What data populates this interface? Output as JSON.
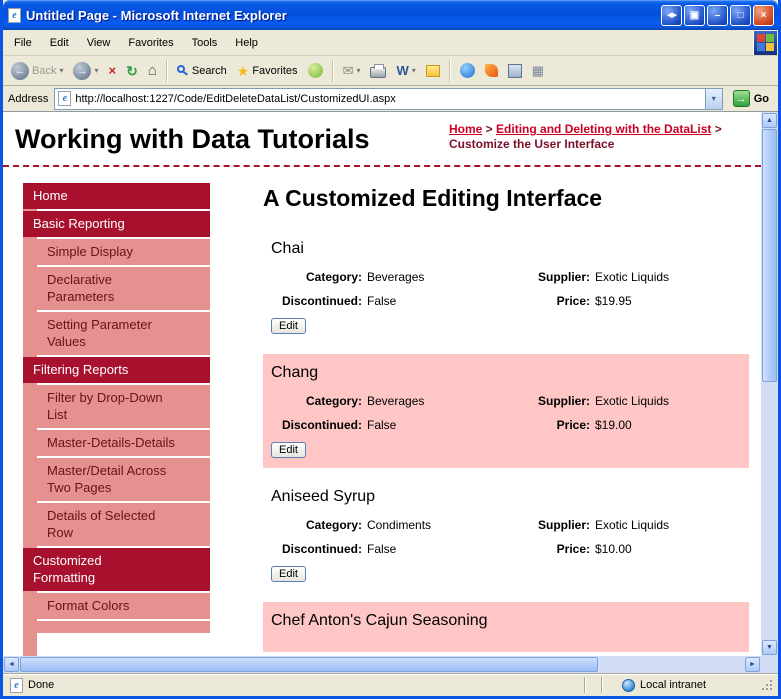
{
  "window": {
    "title": "Untitled Page - Microsoft Internet Explorer",
    "status_text": "Done",
    "zone_text": "Local intranet"
  },
  "menu": {
    "items": [
      "File",
      "Edit",
      "View",
      "Favorites",
      "Tools",
      "Help"
    ]
  },
  "toolbar": {
    "back_label": "Back",
    "search_label": "Search",
    "favorites_label": "Favorites"
  },
  "address": {
    "label": "Address",
    "url": "http://localhost:1227/Code/EditDeleteDataList/CustomizedUI.aspx",
    "go_label": "Go"
  },
  "glyphs": {
    "back_arrow": "←",
    "forward_arrow": "→",
    "dropdown": "▾",
    "stop": "×",
    "refresh": "↻",
    "home": "⌂",
    "star": "★",
    "mail": "✉",
    "word": "W",
    "grid": "▦",
    "go_arrow": "→",
    "minimize": "–",
    "maximize": "□",
    "close": "×",
    "title_extra1": "◀▶",
    "title_extra2": "▣",
    "up": "▲",
    "down": "▼",
    "left": "◄",
    "right": "►"
  },
  "page": {
    "site_title": "Working with Data Tutorials",
    "breadcrumb": {
      "separator": ">",
      "items": [
        {
          "label": "Home",
          "link": true
        },
        {
          "label": "Editing and Deleting with the DataList",
          "link": true
        },
        {
          "label": "Customize the User Interface",
          "link": false
        }
      ]
    },
    "sidebar": [
      {
        "label": "Home",
        "type": "header"
      },
      {
        "label": "Basic Reporting",
        "type": "header"
      },
      {
        "label": "Simple Display",
        "type": "item"
      },
      {
        "label": "Declarative Parameters",
        "type": "item"
      },
      {
        "label": "Setting Parameter Values",
        "type": "item"
      },
      {
        "label": "Filtering Reports",
        "type": "header"
      },
      {
        "label": "Filter by Drop-Down List",
        "type": "item"
      },
      {
        "label": "Master-Details-Details",
        "type": "item"
      },
      {
        "label": "Master/Detail Across Two Pages",
        "type": "item"
      },
      {
        "label": "Details of Selected Row",
        "type": "item"
      },
      {
        "label": "Customized Formatting",
        "type": "header"
      },
      {
        "label": "Format Colors",
        "type": "item"
      },
      {
        "label": "",
        "type": "item",
        "partial": true
      }
    ],
    "heading": "A Customized Editing Interface",
    "labels": {
      "category": "Category:",
      "supplier": "Supplier:",
      "discontinued": "Discontinued:",
      "price": "Price:",
      "edit": "Edit"
    },
    "products": [
      {
        "name": "Chai",
        "category": "Beverages",
        "supplier": "Exotic Liquids",
        "discontinued": "False",
        "price": "$19.95",
        "highlighted": false
      },
      {
        "name": "Chang",
        "category": "Beverages",
        "supplier": "Exotic Liquids",
        "discontinued": "False",
        "price": "$19.00",
        "highlighted": true
      },
      {
        "name": "Aniseed Syrup",
        "category": "Condiments",
        "supplier": "Exotic Liquids",
        "discontinued": "False",
        "price": "$10.00",
        "highlighted": false
      },
      {
        "name": "Chef Anton's Cajun Seasoning",
        "highlighted": true,
        "partial": true
      }
    ]
  },
  "colors": {
    "sidebar_header_bg": "#a8112e",
    "sidebar_header_text": "#ffffff",
    "sidebar_item_bg": "#e59190",
    "sidebar_item_text": "#6b1212",
    "link_color": "#cc0022",
    "breadcrumb_current": "#7a1028",
    "highlight_bg": "#ffc6c6",
    "rule_color": "#a8112e"
  }
}
